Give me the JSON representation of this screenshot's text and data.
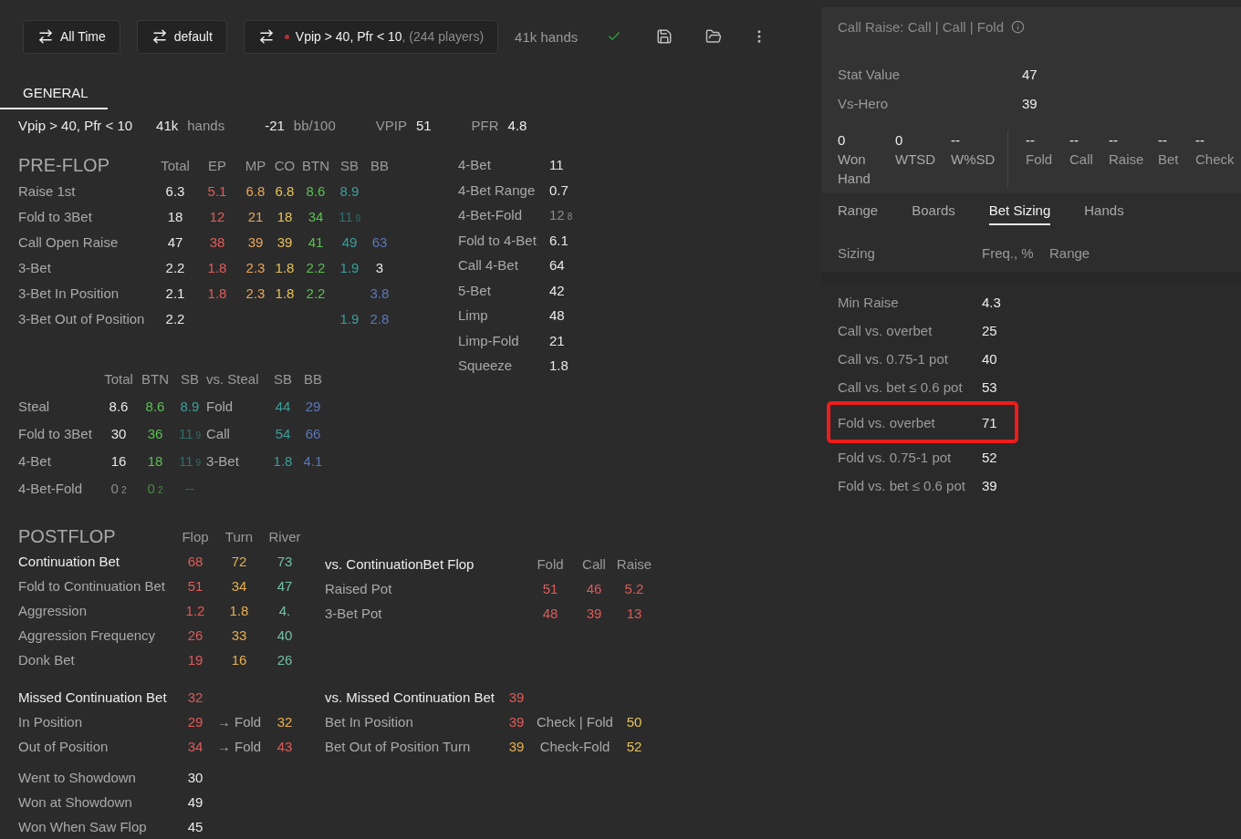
{
  "toolbar": {
    "buttons": [
      {
        "label": "All Time"
      },
      {
        "label": "default"
      }
    ],
    "filter": {
      "label": "Vpip > 40, Pfr < 10",
      "suffix": ", (244 players)"
    },
    "hands": "41k hands"
  },
  "tabs": [
    {
      "label": "GENERAL",
      "selected": true
    }
  ],
  "summary": {
    "name": "Vpip > 40, Pfr < 10",
    "items": [
      {
        "kind": "unit",
        "value": "41k",
        "label": "hands"
      },
      {
        "kind": "unit",
        "value": "-21",
        "label": "bb/100"
      },
      {
        "kind": "stat",
        "label": "VPIP",
        "value": "51"
      },
      {
        "kind": "stat",
        "label": "PFR",
        "value": "4.8"
      }
    ]
  },
  "preflop": {
    "title": "PRE-FLOP",
    "columns": [
      "Total",
      "EP",
      "MP",
      "CO",
      "BTN",
      "SB",
      "BB"
    ],
    "rows": [
      {
        "label": "Raise 1st",
        "values": {
          "total": {
            "text": "6.3",
            "color": "#e8e8e8"
          },
          "ep": {
            "text": "5.1",
            "color": "#e25c5c"
          },
          "mp": {
            "text": "6.8",
            "color": "#e8a55a"
          },
          "co": {
            "text": "6.8",
            "color": "#e6c25a"
          },
          "btn": {
            "text": "8.6",
            "color": "#5cbf55"
          },
          "sb": {
            "text": "8.9",
            "color": "#3a9e9a"
          }
        }
      },
      {
        "label": "Fold to 3Bet",
        "values": {
          "total": {
            "text": "18",
            "color": "#e8e8e8"
          },
          "ep": {
            "text": "12",
            "color": "#e25c5c"
          },
          "mp": {
            "text": "21",
            "color": "#e8a55a"
          },
          "co": {
            "text": "18",
            "color": "#e6c25a"
          },
          "btn": {
            "text": "34",
            "color": "#5cbf55"
          },
          "sb": {
            "text": "11$_{9}$",
            "color": "#2f6e6c"
          }
        }
      },
      {
        "label": "Call Open Raise",
        "values": {
          "total": {
            "text": "47",
            "color": "#e8e8e8"
          },
          "ep": {
            "text": "38",
            "color": "#e25c5c"
          },
          "mp": {
            "text": "39",
            "color": "#e8a55a"
          },
          "co": {
            "text": "39",
            "color": "#e6c25a"
          },
          "btn": {
            "text": "41",
            "color": "#5cbf55"
          },
          "sb": {
            "text": "49",
            "color": "#3a9e9a"
          },
          "bb": {
            "text": "63",
            "color": "#5b78b8"
          }
        }
      },
      {
        "label": "3-Bet",
        "values": {
          "total": {
            "text": "2.2",
            "color": "#e8e8e8"
          },
          "ep": {
            "text": "1.8",
            "color": "#e25c5c"
          },
          "mp": {
            "text": "2.3",
            "color": "#e8a55a"
          },
          "co": {
            "text": "1.8",
            "color": "#e6c25a"
          },
          "btn": {
            "text": "2.2",
            "color": "#5cbf55"
          },
          "sb": {
            "text": "1.9",
            "color": "#3a9e9a"
          },
          "bb": {
            "text": "3",
            "color": "#e8e8e8"
          }
        }
      },
      {
        "label": "3-Bet In Position",
        "values": {
          "total": {
            "text": "2.1",
            "color": "#e8e8e8"
          },
          "ep": {
            "text": "1.8",
            "color": "#e25c5c"
          },
          "mp": {
            "text": "2.3",
            "color": "#e8a55a"
          },
          "co": {
            "text": "1.8",
            "color": "#e6c25a"
          },
          "btn": {
            "text": "2.2",
            "color": "#5cbf55"
          },
          "bb": {
            "text": "3.8",
            "color": "#5b78b8"
          }
        }
      },
      {
        "label": "3-Bet Out of Position",
        "values": {
          "total": {
            "text": "2.2",
            "color": "#e8e8e8"
          },
          "sb": {
            "text": "1.9",
            "color": "#3a9e9a"
          },
          "bb": {
            "text": "2.8",
            "color": "#5b78b8"
          }
        }
      }
    ]
  },
  "preflop_side": {
    "rows": [
      {
        "label": "4-Bet",
        "values": [
          {
            "text": "11",
            "color": "#e8e8e8"
          }
        ]
      },
      {
        "label": "4-Bet Range",
        "values": [
          {
            "text": "0.7",
            "color": "#e8e8e8"
          }
        ]
      },
      {
        "label": "4-Bet-Fold",
        "values": [
          {
            "text": "12$_{8}$",
            "color": "#8c8c8c"
          }
        ]
      },
      {
        "label": "Fold to 4-Bet",
        "values": [
          {
            "text": "6.1",
            "color": "#e8e8e8"
          }
        ]
      },
      {
        "label": "Call 4-Bet",
        "values": [
          {
            "text": "64",
            "color": "#e8e8e8"
          }
        ]
      },
      {
        "label": "5-Bet",
        "values": [
          {
            "text": "42",
            "color": "#e8e8e8"
          }
        ]
      },
      {
        "label": "Limp",
        "values": [
          {
            "text": "48",
            "color": "#e8e8e8"
          }
        ]
      },
      {
        "label": "Limp-Fold",
        "values": [
          {
            "text": "21",
            "color": "#e8e8e8"
          }
        ]
      },
      {
        "label": "Squeeze",
        "values": [
          {
            "text": "1.8",
            "color": "#e8e8e8"
          }
        ]
      }
    ]
  },
  "steal": {
    "columns": [
      "Total",
      "BTN",
      "SB",
      "vs. Steal",
      "SB",
      "BB"
    ],
    "rows": [
      {
        "label": "Steal",
        "values": [
          {
            "text": "8.6",
            "color": "#e8e8e8"
          },
          {
            "text": "8.6",
            "color": "#5cbf55"
          },
          {
            "text": "8.9",
            "color": "#3a9e9a"
          },
          {
            "text": "Fold"
          },
          {
            "text": "44",
            "color": "#3a9e9a"
          },
          {
            "text": "29",
            "color": "#5b78b8"
          }
        ]
      },
      {
        "label": "Fold to 3Bet",
        "values": [
          {
            "text": "30",
            "color": "#e8e8e8"
          },
          {
            "text": "36",
            "color": "#5cbf55"
          },
          {
            "text": "11$_{9}$",
            "color": "#2f6e6c"
          },
          {
            "text": "Call"
          },
          {
            "text": "54",
            "color": "#3a9e9a"
          },
          {
            "text": "66",
            "color": "#5b78b8"
          }
        ]
      },
      {
        "label": "4-Bet",
        "values": [
          {
            "text": "16",
            "color": "#e8e8e8"
          },
          {
            "text": "18",
            "color": "#5cbf55"
          },
          {
            "text": "11$_{9}$",
            "color": "#2f6e6c"
          },
          {
            "text": "3-Bet"
          },
          {
            "text": "1.8",
            "color": "#3a9e9a"
          },
          {
            "text": "4.1",
            "color": "#5b78b8"
          }
        ]
      },
      {
        "label": "4-Bet-Fold",
        "values": [
          {
            "text": "0$_{2}$",
            "color": "#8c8c8c"
          },
          {
            "text": "0$_{2}$",
            "color": "#4a8a44"
          },
          {
            "text": "--",
            "color": "#2f6e6c"
          }
        ]
      }
    ]
  },
  "postflop": {
    "title": "POSTFLOP",
    "columns": [
      "Flop",
      "Turn",
      "River"
    ],
    "rows": [
      {
        "kind": "heading",
        "label": "Continuation Bet",
        "values": [
          {
            "text": "68",
            "color": "#e05a5a"
          },
          {
            "text": "72",
            "color": "#e8b04f"
          },
          {
            "text": "73",
            "color": "#72c0a6"
          }
        ]
      },
      {
        "kind": "stat",
        "label": "Fold to Continuation Bet",
        "values": [
          {
            "text": "51",
            "color": "#e05a5a"
          },
          {
            "text": "34",
            "color": "#e8b04f"
          },
          {
            "text": "47",
            "color": "#72c0a6"
          }
        ]
      },
      {
        "kind": "stat",
        "label": "Aggression",
        "values": [
          {
            "text": "1.2",
            "color": "#e05a5a"
          },
          {
            "text": "1.8",
            "color": "#e8b04f"
          },
          {
            "text": "4.",
            "color": "#72c0a6"
          }
        ]
      },
      {
        "kind": "stat",
        "label": "Aggression Frequency",
        "values": [
          {
            "text": "26",
            "color": "#e05a5a"
          },
          {
            "text": "33",
            "color": "#e8b04f"
          },
          {
            "text": "40",
            "color": "#72c0a6"
          }
        ]
      },
      {
        "kind": "stat",
        "label": "Donk Bet",
        "values": [
          {
            "text": "19",
            "color": "#e05a5a"
          },
          {
            "text": "16",
            "color": "#e8b04f"
          },
          {
            "text": "26",
            "color": "#72c0a6"
          }
        ]
      }
    ]
  },
  "vs_cbet": {
    "heading": "vs. ContinuationBet Flop",
    "columns": [
      "Fold",
      "Call",
      "Raise"
    ],
    "rows": [
      {
        "label": "Raised Pot",
        "values": [
          {
            "text": "51",
            "color": "#e05a5a"
          },
          {
            "text": "46",
            "color": "#e05a5a"
          },
          {
            "text": "5.2",
            "color": "#e05a5a"
          }
        ]
      },
      {
        "label": "3-Bet Pot",
        "values": [
          {
            "text": "48",
            "color": "#e05a5a"
          },
          {
            "text": "39",
            "color": "#e05a5a"
          },
          {
            "text": "13",
            "color": "#e05a5a"
          }
        ]
      }
    ]
  },
  "missed_cbet": {
    "rows": [
      {
        "kind": "heading",
        "label": "Missed Continuation Bet",
        "values": [
          {
            "text": "32",
            "color": "#e05a5a"
          }
        ]
      },
      {
        "kind": "stat",
        "label": "In Position",
        "values": [
          {
            "text": "29",
            "color": "#e05a5a"
          },
          {
            "text": "→ Fold"
          },
          {
            "text": "32",
            "color": "#e8b04f"
          }
        ]
      },
      {
        "kind": "stat",
        "label": "Out of Position",
        "values": [
          {
            "text": "34",
            "color": "#e05a5a"
          },
          {
            "text": "→ Fold"
          },
          {
            "text": "43",
            "color": "#e05a5a"
          }
        ]
      }
    ]
  },
  "vs_missed_cbet": {
    "rows": [
      {
        "kind": "heading",
        "label": "vs. Missed Continuation Bet",
        "values": [
          {
            "text": "39",
            "color": "#e05a5a"
          }
        ]
      },
      {
        "kind": "stat",
        "label": "Bet In Position",
        "values": [
          {
            "text": "39",
            "color": "#e05a5a"
          },
          {
            "text": "Check | Fold"
          },
          {
            "text": "50",
            "color": "#e6c25a"
          }
        ]
      },
      {
        "kind": "stat",
        "label": "Bet Out of Position Turn",
        "values": [
          {
            "text": "39",
            "color": "#e8b04f"
          },
          {
            "text": "Check-Fold"
          },
          {
            "text": "52",
            "color": "#e6c25a"
          }
        ]
      }
    ]
  },
  "showdown": {
    "rows": [
      {
        "label": "Went to Showdown",
        "values": [
          {
            "text": "30",
            "color": "#e8e8e8"
          }
        ]
      },
      {
        "label": "Won at Showdown",
        "values": [
          {
            "text": "49",
            "color": "#e8e8e8"
          }
        ]
      },
      {
        "label": "Won When Saw Flop",
        "values": [
          {
            "text": "45",
            "color": "#e8e8e8"
          }
        ]
      }
    ]
  },
  "detail": {
    "title": "Call Raise: Call | Call | Fold",
    "values": [
      {
        "label": "Stat Value",
        "value": "47"
      },
      {
        "label": "Vs-Hero",
        "value": "39"
      }
    ],
    "hero_stats": [
      {
        "value": "0",
        "label": "Won Hand"
      },
      {
        "value": "0",
        "label": "WTSD"
      },
      {
        "value": "--",
        "label": "W%SD"
      }
    ],
    "action_stats": [
      {
        "value": "--",
        "label": "Fold"
      },
      {
        "value": "--",
        "label": "Call"
      },
      {
        "value": "--",
        "label": "Raise"
      },
      {
        "value": "--",
        "label": "Bet"
      },
      {
        "value": "--",
        "label": "Check"
      }
    ]
  },
  "detail_tabs": [
    {
      "label": "Range",
      "selected": false
    },
    {
      "label": "Boards",
      "selected": false
    },
    {
      "label": "Bet Sizing",
      "selected": true
    },
    {
      "label": "Hands",
      "selected": false
    }
  ],
  "sizing": {
    "columns": [
      "Sizing",
      "Freq., %",
      "Range"
    ],
    "rows": [
      {
        "label": "Min Raise",
        "value": "4.3",
        "highlighted": false
      },
      {
        "label": "Call vs. overbet",
        "value": "25",
        "highlighted": false
      },
      {
        "label": "Call vs. 0.75-1 pot",
        "value": "40",
        "highlighted": false
      },
      {
        "label": "Call vs. bet ≤ 0.6 pot",
        "value": "53",
        "highlighted": false
      },
      {
        "label": "Fold vs. overbet",
        "value": "71",
        "highlighted": true
      },
      {
        "label": "Fold vs. 0.75-1 pot",
        "value": "52",
        "highlighted": false
      },
      {
        "label": "Fold vs. bet ≤ 0.6 pot",
        "value": "39",
        "highlighted": false
      }
    ]
  }
}
